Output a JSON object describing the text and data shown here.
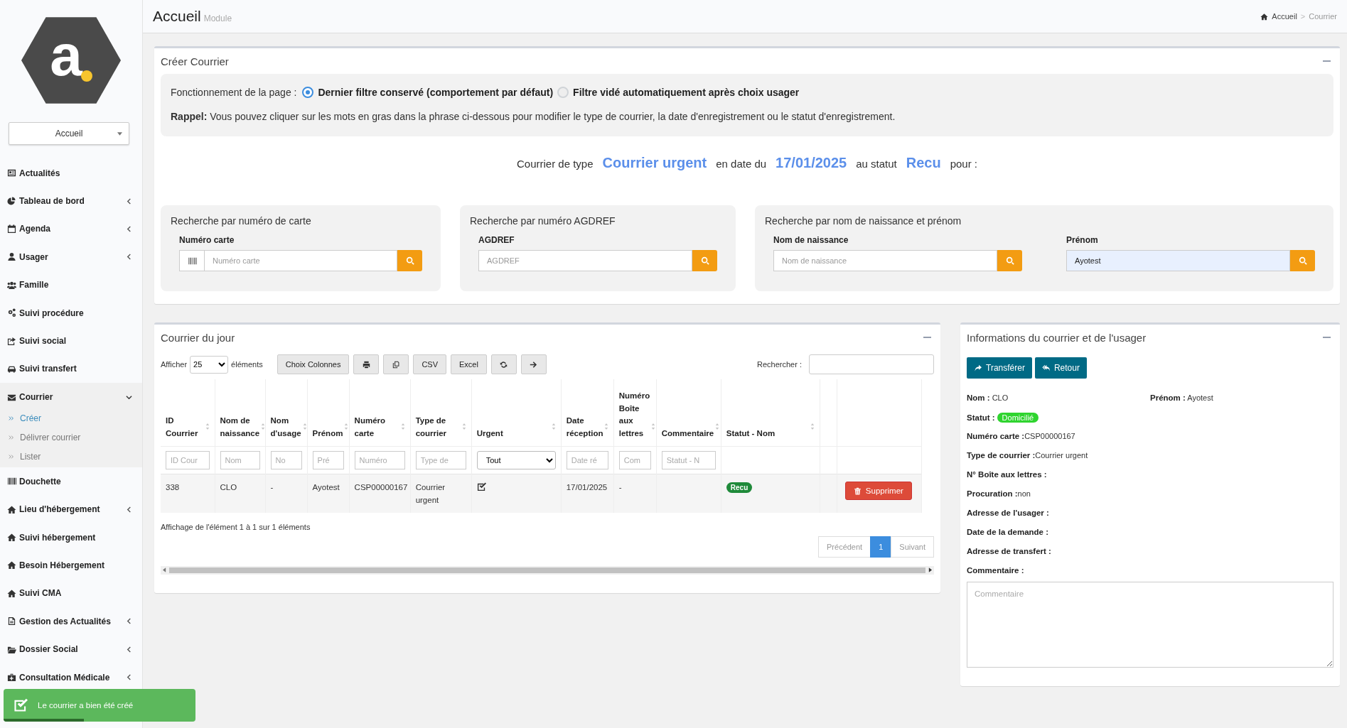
{
  "logo": {
    "letter": "a"
  },
  "sidebar": {
    "module_select": "Accueil",
    "items": [
      {
        "label": "Actualités",
        "collapsible": false
      },
      {
        "label": "Tableau de bord",
        "collapsible": true,
        "expanded": false
      },
      {
        "label": "Agenda",
        "collapsible": true,
        "expanded": false
      },
      {
        "label": "Usager",
        "collapsible": true,
        "expanded": false
      },
      {
        "label": "Famille",
        "collapsible": false
      },
      {
        "label": "Suivi procédure",
        "collapsible": false
      },
      {
        "label": "Suivi social",
        "collapsible": false
      },
      {
        "label": "Suivi transfert",
        "collapsible": false
      },
      {
        "label": "Courrier",
        "collapsible": true,
        "expanded": true,
        "children": [
          {
            "label": "Créer",
            "selected": true
          },
          {
            "label": "Délivrer courrier",
            "selected": false
          },
          {
            "label": "Lister",
            "selected": false
          }
        ]
      },
      {
        "label": "Douchette",
        "collapsible": false
      },
      {
        "label": "Lieu d'hébergement",
        "collapsible": true,
        "expanded": false
      },
      {
        "label": "Suivi hébergement",
        "collapsible": false
      },
      {
        "label": "Besoin Hébergement",
        "collapsible": false
      },
      {
        "label": "Suivi CMA",
        "collapsible": false
      },
      {
        "label": "Gestion des Actualités",
        "collapsible": true,
        "expanded": false
      },
      {
        "label": "Dossier Social",
        "collapsible": true,
        "expanded": false
      },
      {
        "label": "Consultation Médicale",
        "collapsible": true,
        "expanded": false
      }
    ]
  },
  "header": {
    "title": "Accueil",
    "subtitle": "Module",
    "breadcrumb": {
      "items": [
        "Accueil",
        "Courrier"
      ],
      "separator": ">"
    }
  },
  "create_panel": {
    "title": "Créer Courrier",
    "mode_label": "Fonctionnement de la page :",
    "mode_options": [
      {
        "label": "Dernier filtre conservé (comportement par défaut)",
        "selected": true
      },
      {
        "label": "Filtre vidé automatiquement après choix usager",
        "selected": false
      }
    ],
    "reminder": "**Rappel:** Vous pouvez cliquer sur les mots en gras dans la phrase ci-dessous pour modifier le type de courrier, la date d'enregistrement ou le statut d'enregistrement.",
    "sentence": [
      {
        "kind": "text",
        "text": "Courrier de type"
      },
      {
        "kind": "link",
        "text": "Courrier urgent"
      },
      {
        "kind": "text",
        "text": "en date du"
      },
      {
        "kind": "link",
        "text": "17/01/2025"
      },
      {
        "kind": "text",
        "text": "au statut"
      },
      {
        "kind": "link",
        "text": "Recu"
      },
      {
        "kind": "text",
        "text": "pour :"
      }
    ],
    "search_cards": [
      {
        "title": "Recherche par numéro de carte",
        "fields": [
          {
            "label": "Numéro carte",
            "placeholder": "Numéro carte",
            "barcode_addon": true,
            "autofilled": false
          }
        ]
      },
      {
        "title": "Recherche par numéro AGDREF",
        "fields": [
          {
            "label": "AGDREF",
            "placeholder": "AGDREF",
            "barcode_addon": false,
            "autofilled": false
          }
        ]
      },
      {
        "title": "Recherche par nom de naissance et prénom",
        "fields": [
          {
            "label": "Nom de naissance",
            "placeholder": "Nom de naissance",
            "barcode_addon": false,
            "autofilled": false
          },
          {
            "label": "Prénom",
            "value": "Ayotest",
            "barcode_addon": false,
            "autofilled": true
          }
        ]
      }
    ]
  },
  "daily_mail": {
    "title": "Courrier du jour",
    "length_before": "Afficher",
    "length_value": "25",
    "length_after": "éléments",
    "buttons": [
      {
        "kind": "text",
        "label": "Choix Colonnes"
      },
      {
        "kind": "print"
      },
      {
        "kind": "copy"
      },
      {
        "kind": "text",
        "label": "CSV"
      },
      {
        "kind": "text",
        "label": "Excel"
      },
      {
        "kind": "refresh"
      },
      {
        "kind": "arrow"
      }
    ],
    "search_label": "Rechercher :",
    "table": {
      "columns": [
        {
          "label": "ID Courrier",
          "sortable": true
        },
        {
          "label": "Nom de naissance",
          "sortable": true
        },
        {
          "label": "Nom d'usage",
          "sortable": true
        },
        {
          "label": "Prénom",
          "sortable": true
        },
        {
          "label": "Numéro carte",
          "sortable": true
        },
        {
          "label": "Type de courrier",
          "sortable": true
        },
        {
          "label": "Urgent",
          "sortable": true
        },
        {
          "label": "Date réception",
          "sortable": true
        },
        {
          "label": "Numéro Boîte aux lettres",
          "sortable": true
        },
        {
          "label": "Commentaire",
          "sortable": true
        },
        {
          "label": "Statut - Nom",
          "sortable": true
        },
        {
          "sortable": false
        },
        {
          "sortable": false
        }
      ],
      "filters": [
        {
          "kind": "text",
          "placeholder": "ID Cour"
        },
        {
          "kind": "text",
          "placeholder": "Nom"
        },
        {
          "kind": "text",
          "placeholder": "No"
        },
        {
          "kind": "text",
          "placeholder": "Pré"
        },
        {
          "kind": "text",
          "placeholder": "Numéro"
        },
        {
          "kind": "text",
          "placeholder": "Type de"
        },
        {
          "kind": "select",
          "value": "Tout"
        },
        {
          "kind": "text",
          "placeholder": "Date ré"
        },
        {
          "kind": "text",
          "placeholder": "Com"
        },
        {
          "kind": "text",
          "placeholder": "Statut - N"
        },
        {
          "kind": "none"
        },
        {
          "kind": "none"
        },
        {
          "kind": "none"
        }
      ],
      "rows": [
        {
          "cells": [
            {
              "kind": "text",
              "text": "338"
            },
            {
              "kind": "text",
              "text": "CLO"
            },
            {
              "kind": "text",
              "text": "-"
            },
            {
              "kind": "text",
              "text": "Ayotest"
            },
            {
              "kind": "text",
              "text": "CSP00000167"
            },
            {
              "kind": "text",
              "text": "Courrier urgent"
            },
            {
              "kind": "check",
              "checked": true
            },
            {
              "kind": "text",
              "text": "17/01/2025"
            },
            {
              "kind": "text",
              "text": "-"
            },
            {
              "kind": "empty"
            },
            {
              "kind": "badge",
              "text": "Recu"
            },
            {
              "kind": "empty"
            },
            {
              "kind": "delete",
              "text": "Supprimer"
            }
          ]
        }
      ]
    },
    "info": "Affichage de l'élément 1 à 1 sur 1 éléments",
    "pagination": [
      {
        "label": "Précédent",
        "selected": false
      },
      {
        "label": "1",
        "selected": true
      },
      {
        "label": "Suivant",
        "selected": false
      }
    ]
  },
  "info_panel": {
    "title": "Informations du courrier et de l'usager",
    "buttons": [
      {
        "kind": "transfer",
        "label": "Transférer"
      },
      {
        "kind": "back",
        "label": "Retour"
      }
    ],
    "identity": [
      {
        "label": "Nom :",
        "value": "CLO"
      },
      {
        "label": "Prénom :",
        "value": "Ayotest"
      }
    ],
    "fields": [
      {
        "kind": "badge",
        "label": "Statut :",
        "value": "Domicilié"
      },
      {
        "kind": "text",
        "label": "Numéro carte :",
        "value": "CSP00000167"
      },
      {
        "kind": "text",
        "label": "Type de courrier :",
        "value": "Courrier urgent"
      },
      {
        "kind": "text",
        "label": "N° Boîte aux lettres :"
      },
      {
        "kind": "text",
        "label": "Procuration :",
        "value": "non"
      },
      {
        "kind": "text",
        "label": "Adresse de l'usager :"
      },
      {
        "kind": "text",
        "label": "Date de la demande :"
      },
      {
        "kind": "text",
        "label": "Adresse de transfert :"
      },
      {
        "kind": "text",
        "label": "Commentaire :"
      }
    ],
    "comment_placeholder": "Commentaire"
  },
  "toast": {
    "message": "Le courrier a bien été créé",
    "level": 0.42
  }
}
